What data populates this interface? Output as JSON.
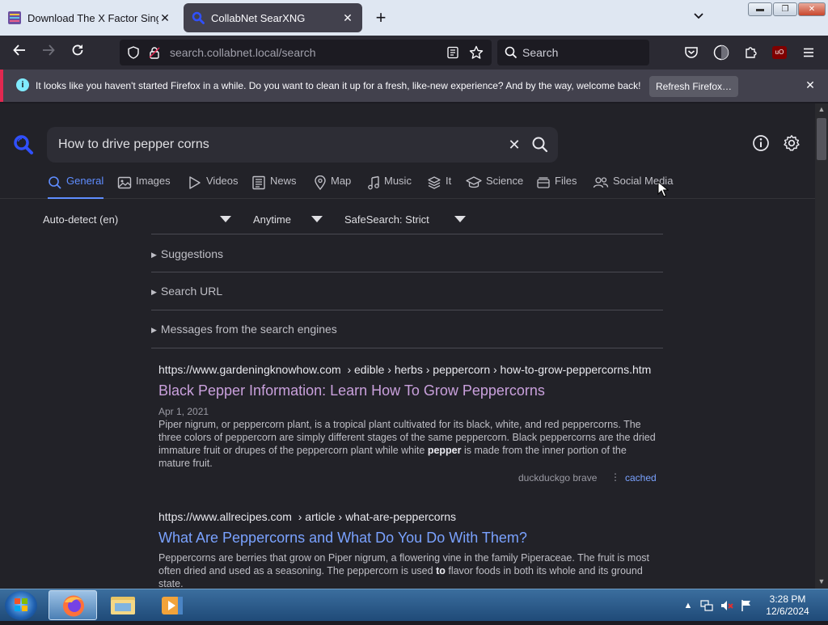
{
  "browser": {
    "tabs": [
      {
        "title": "Download The X Factor Sing (W",
        "active": false
      },
      {
        "title": "CollabNet SearXNG",
        "active": true
      }
    ],
    "url_host": "search.collabnet.local",
    "url_path": "/search",
    "search_placeholder": "Search",
    "notification": {
      "text": "It looks like you haven't started Firefox in a while. Do you want to clean it up for a fresh, like-new experience? And by the way, welcome back!",
      "button": "Refresh Firefox…"
    }
  },
  "search": {
    "query": "How to drive pepper corns",
    "categories": [
      {
        "label": "General",
        "icon": "search-icon",
        "active": true
      },
      {
        "label": "Images",
        "icon": "image-icon",
        "active": false
      },
      {
        "label": "Videos",
        "icon": "play-icon",
        "active": false
      },
      {
        "label": "News",
        "icon": "newspaper-icon",
        "active": false
      },
      {
        "label": "Map",
        "icon": "map-pin-icon",
        "active": false
      },
      {
        "label": "Music",
        "icon": "music-note-icon",
        "active": false
      },
      {
        "label": "It",
        "icon": "layers-icon",
        "active": false
      },
      {
        "label": "Science",
        "icon": "graduation-cap-icon",
        "active": false
      },
      {
        "label": "Files",
        "icon": "files-icon",
        "active": false
      },
      {
        "label": "Social Media",
        "icon": "people-icon",
        "active": false
      }
    ],
    "filters": {
      "language": "Auto-detect (en)",
      "time": "Anytime",
      "safesearch": "SafeSearch: Strict"
    },
    "sections": [
      "Suggestions",
      "Search URL",
      "Messages from the search engines"
    ],
    "results": [
      {
        "url": "https://www.gardeningknowhow.com",
        "crumbs": "› edible › herbs › peppercorn › how-to-grow-peppercorns.htm",
        "title": "Black Pepper Information: Learn How To Grow Peppercorns",
        "visited": true,
        "date": "Apr 1, 2021",
        "snippet_before": "Piper nigrum, or peppercorn plant, is a tropical plant cultivated for its black, white, and red peppercorns. The three colors of peppercorn are simply different stages of the same peppercorn. Black peppercorns are the dried immature fruit or drupes of the peppercorn plant while white ",
        "snippet_bold": "pepper",
        "snippet_after": " is made from the inner portion of the mature fruit.",
        "engines": "duckduckgo  brave",
        "cached": "cached"
      },
      {
        "url": "https://www.allrecipes.com",
        "crumbs": "› article › what-are-peppercorns",
        "title": "What Are Peppercorns and What Do You Do With Them?",
        "visited": false,
        "snippet_before": "Peppercorns are berries that grow on Piper nigrum, a flowering vine in the family Piperaceae. The fruit is most often dried and used as a seasoning. The peppercorn is used ",
        "snippet_bold": "to",
        "snippet_after": " flavor foods in both its whole and its ground state."
      }
    ]
  },
  "taskbar": {
    "time": "3:28 PM",
    "date": "12/6/2024"
  },
  "colors": {
    "accent": "#5f8dff",
    "visited_link": "#c9a0dc",
    "link": "#7aa2ff",
    "notification_border": "#e22850"
  }
}
